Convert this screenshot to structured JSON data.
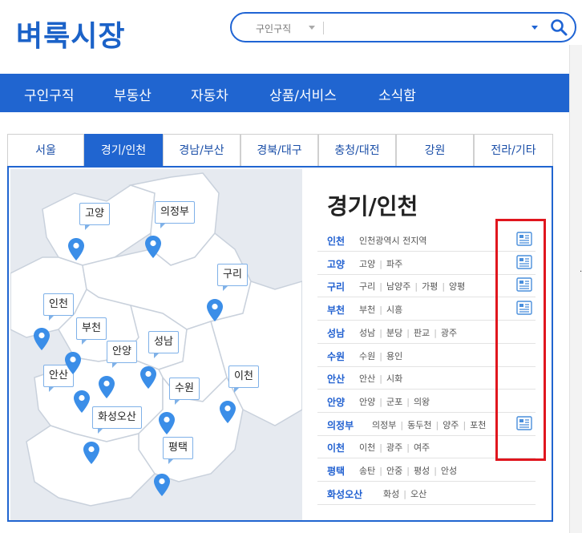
{
  "logo": "벼룩시장",
  "search": {
    "category": "구인구직",
    "placeholder": ""
  },
  "nav": [
    "구인구직",
    "부동산",
    "자동차",
    "상품/서비스",
    "소식함"
  ],
  "tabs": [
    "서울",
    "경기/인천",
    "경남/부산",
    "경북/대구",
    "충청/대전",
    "강원",
    "전라/기타"
  ],
  "active_tab": 1,
  "region_title": "경기/인천",
  "map_labels": [
    "고양",
    "의정부",
    "구리",
    "인천",
    "부천",
    "안양",
    "성남",
    "안산",
    "수원",
    "이천",
    "화성오산",
    "평택"
  ],
  "rows": [
    {
      "name": "인천",
      "towns": [
        "인천광역시 전지역"
      ],
      "icon": true
    },
    {
      "name": "고양",
      "towns": [
        "고양",
        "파주"
      ],
      "icon": true
    },
    {
      "name": "구리",
      "towns": [
        "구리",
        "남양주",
        "가평",
        "양평"
      ],
      "icon": true
    },
    {
      "name": "부천",
      "towns": [
        "부천",
        "시흥"
      ],
      "icon": true
    },
    {
      "name": "성남",
      "towns": [
        "성남",
        "분당",
        "판교",
        "광주"
      ],
      "icon": false
    },
    {
      "name": "수원",
      "towns": [
        "수원",
        "용인"
      ],
      "icon": false
    },
    {
      "name": "안산",
      "towns": [
        "안산",
        "시화"
      ],
      "icon": false
    },
    {
      "name": "안양",
      "towns": [
        "안양",
        "군포",
        "의왕"
      ],
      "icon": false
    },
    {
      "name": "의정부",
      "towns": [
        "의정부",
        "동두천",
        "양주",
        "포천"
      ],
      "icon": true
    },
    {
      "name": "이천",
      "towns": [
        "이천",
        "광주",
        "여주"
      ],
      "icon": false
    },
    {
      "name": "평택",
      "towns": [
        "송탄",
        "안중",
        "평성",
        "안성"
      ],
      "icon": false
    },
    {
      "name": "화성오산",
      "towns": [
        "화성",
        "오산"
      ],
      "icon": false
    }
  ],
  "colors": {
    "brand": "#1b62c8",
    "nav": "#2065d0",
    "highlight": "#e0161e",
    "pin": "#3b8ee8"
  }
}
